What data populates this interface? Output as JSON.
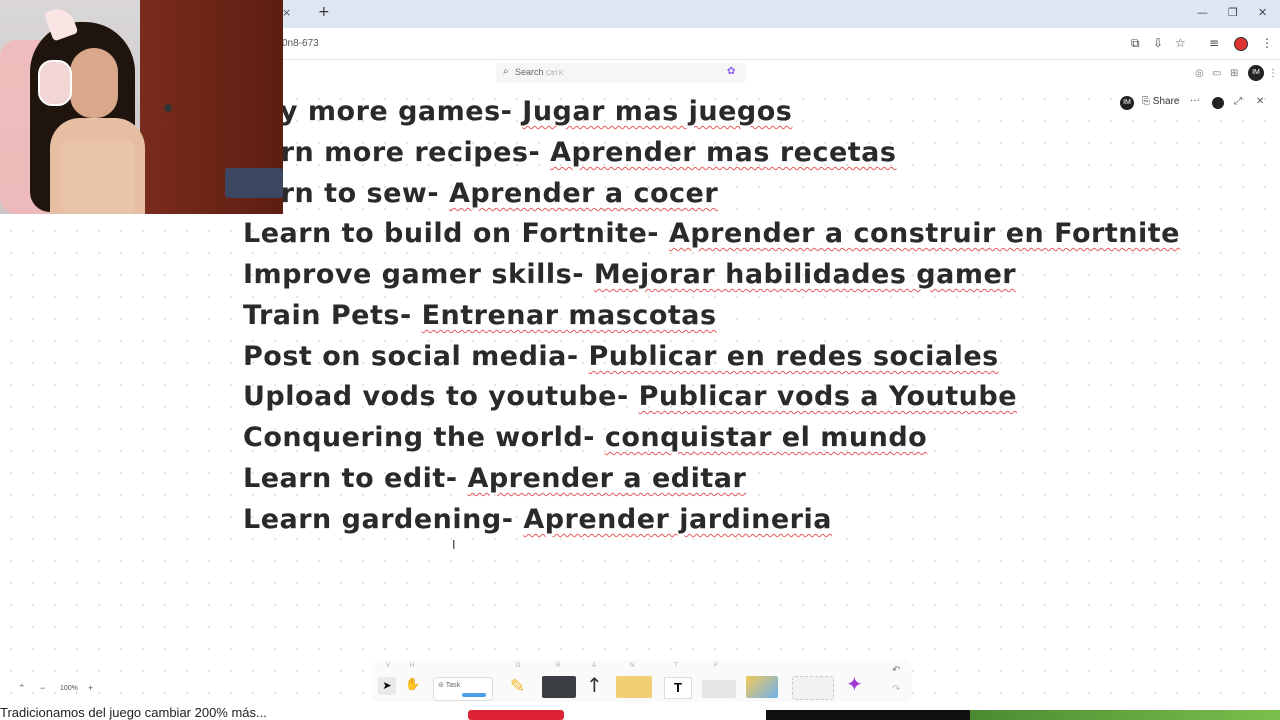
{
  "browser": {
    "url_fragment": "0n8-673",
    "new_tab": "+",
    "tab_close": "×",
    "window_controls": [
      "—",
      "❐",
      "✕"
    ]
  },
  "app": {
    "search_placeholder": "Search",
    "search_shortcut": "Ctrl K",
    "share_label": "Share",
    "avatar_initials": "IM"
  },
  "lines": [
    {
      "en": "ay more games-",
      "es": "Jugar mas juegos"
    },
    {
      "en": "arn more recipes-",
      "es": "Aprender mas recetas"
    },
    {
      "en": "arn to sew-",
      "es": "Aprender a cocer"
    },
    {
      "en": "Learn to build on Fortnite-",
      "es": "Aprender a construir en Fortnite"
    },
    {
      "en": "Improve gamer skills-",
      "es": "Mejorar habilidades gamer"
    },
    {
      "en": "Train Pets-",
      "es": "Entrenar mascotas"
    },
    {
      "en": "Post on social media-",
      "es": "Publicar en redes sociales"
    },
    {
      "en": "Upload vods to youtube-",
      "es": "Publicar vods a Youtube"
    },
    {
      "en": "Conquering the world-",
      "es": "conquistar el mundo"
    },
    {
      "en": "Learn to edit-",
      "es": "Aprender a editar"
    },
    {
      "en": "Learn gardening-",
      "es": "Aprender jardineria"
    }
  ],
  "zoom": {
    "level": "100%",
    "minus": "−",
    "plus": "+"
  },
  "toolbar": {
    "task_label": "Task",
    "text_tool": "T",
    "shortcuts": [
      "V",
      "H",
      "",
      "D",
      "R",
      "A",
      "N",
      "T",
      "F"
    ]
  },
  "subtitle": "Tradicionamos del juego cambiar 200% más...",
  "colors": {
    "accent": "#8a5cf6",
    "underline": "#e85a5a",
    "text": "#2a2a2a"
  }
}
